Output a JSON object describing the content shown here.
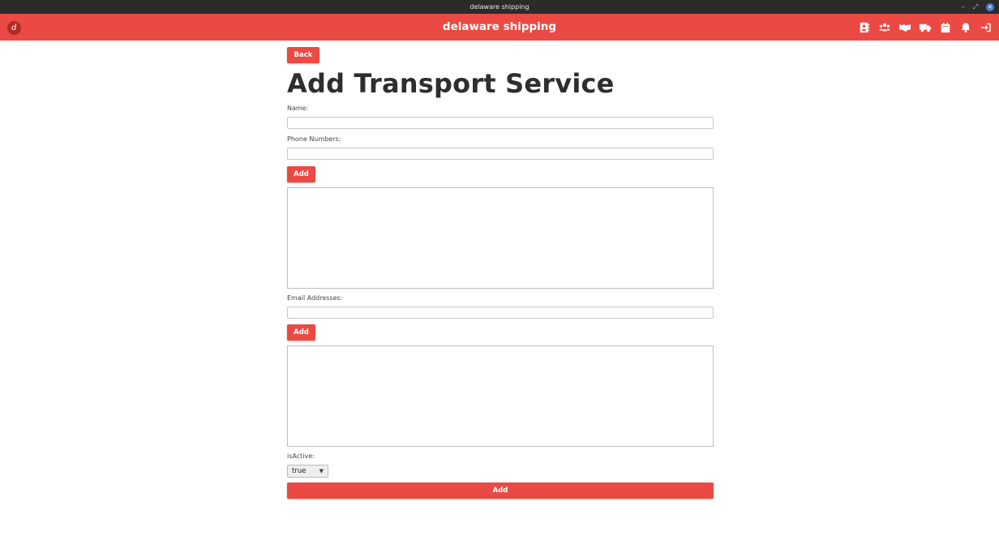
{
  "window": {
    "title": "delaware shipping",
    "controls": {
      "minimize": "–",
      "maximize": "⤢",
      "close": "✕"
    }
  },
  "header": {
    "logo_text": "d",
    "title": "delaware shipping",
    "nav_icons": [
      "address-book-icon",
      "users-icon",
      "handshake-icon",
      "truck-icon",
      "calendar-icon",
      "bell-icon",
      "sign-out-icon"
    ]
  },
  "form": {
    "back_label": "Back",
    "title": "Add Transport Service",
    "name_label": "Name:",
    "name_value": "",
    "phone_label": "Phone Numbers:",
    "phone_value": "",
    "phone_add_label": "Add",
    "email_label": "Email Addresses:",
    "email_value": "",
    "email_add_label": "Add",
    "active_label": "isActive:",
    "active_selected": "true",
    "submit_label": "Add"
  },
  "colors": {
    "accent": "#ea4a43",
    "titlebar": "#2b2b2b"
  }
}
